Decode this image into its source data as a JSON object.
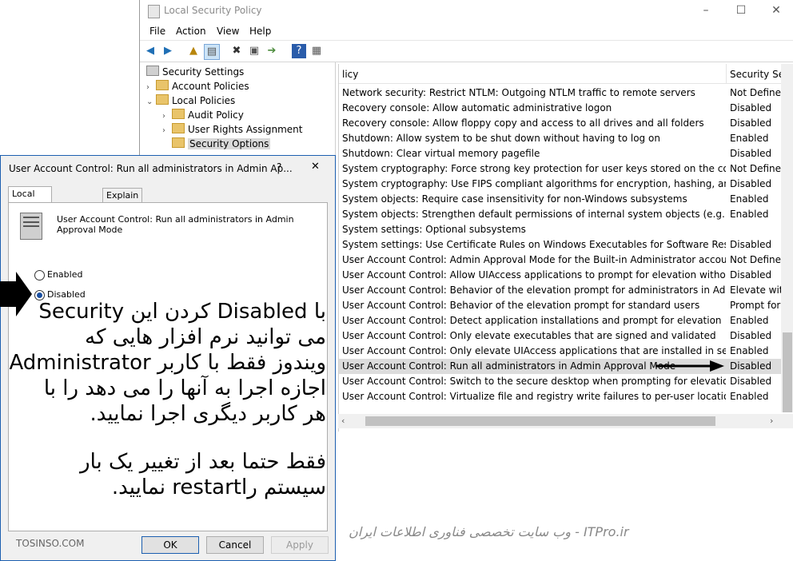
{
  "window": {
    "title": "Local Security Policy",
    "controls": {
      "minimize": "–",
      "maximize": "☐",
      "close": "✕"
    }
  },
  "menu": {
    "items": [
      "File",
      "Action",
      "View",
      "Help"
    ]
  },
  "tree": {
    "root": "Security Settings",
    "account_policies": "Account Policies",
    "local_policies": "Local Policies",
    "audit_policy": "Audit Policy",
    "user_rights": "User Rights Assignment",
    "security_options": "Security Options"
  },
  "list": {
    "col_policy": "licy",
    "col_setting": "Security Setti",
    "rows": [
      {
        "policy": "Network security: Restrict NTLM: Outgoing NTLM traffic to remote servers",
        "setting": "Not Defined"
      },
      {
        "policy": "Recovery console: Allow automatic administrative logon",
        "setting": "Disabled"
      },
      {
        "policy": "Recovery console: Allow floppy copy and access to all drives and all folders",
        "setting": "Disabled"
      },
      {
        "policy": "Shutdown: Allow system to be shut down without having to log on",
        "setting": "Enabled"
      },
      {
        "policy": "Shutdown: Clear virtual memory pagefile",
        "setting": "Disabled"
      },
      {
        "policy": "System cryptography: Force strong key protection for user keys stored on the computer",
        "setting": "Not Defined"
      },
      {
        "policy": "System cryptography: Use FIPS compliant algorithms for encryption, hashing, and signing",
        "setting": "Disabled"
      },
      {
        "policy": "System objects: Require case insensitivity for non-Windows subsystems",
        "setting": "Enabled"
      },
      {
        "policy": "System objects: Strengthen default permissions of internal system objects (e.g. Symbolic ...",
        "setting": "Enabled"
      },
      {
        "policy": "System settings: Optional subsystems",
        "setting": ""
      },
      {
        "policy": "System settings: Use Certificate Rules on Windows Executables for Software Restriction P...",
        "setting": "Disabled"
      },
      {
        "policy": "User Account Control: Admin Approval Mode for the Built-in Administrator account",
        "setting": "Not Defined"
      },
      {
        "policy": "User Account Control: Allow UIAccess applications to prompt for elevation without usin...",
        "setting": "Disabled"
      },
      {
        "policy": "User Account Control: Behavior of the elevation prompt for administrators in Admin App...",
        "setting": "Elevate with"
      },
      {
        "policy": "User Account Control: Behavior of the elevation prompt for standard users",
        "setting": "Prompt for c"
      },
      {
        "policy": "User Account Control: Detect application installations and prompt for elevation",
        "setting": "Enabled"
      },
      {
        "policy": "User Account Control: Only elevate executables that are signed and validated",
        "setting": "Disabled"
      },
      {
        "policy": "User Account Control: Only elevate UIAccess applications that are installed in secure loca...",
        "setting": "Enabled"
      },
      {
        "policy": "User Account Control: Run all administrators in Admin Approval Mode",
        "setting": "Disabled",
        "highlighted": true
      },
      {
        "policy": "User Account Control: Switch to the secure desktop when prompting for elevation",
        "setting": "Disabled"
      },
      {
        "policy": "User Account Control: Virtualize file and registry write failures to per-user locations",
        "setting": "Enabled"
      }
    ]
  },
  "dialog": {
    "title": "User Account Control: Run all administrators in Admin Ap...",
    "help": "?",
    "close": "✕",
    "tab_local": "Local Security Setting",
    "tab_explain": "Explain",
    "policy_name": "User Account Control: Run all administrators in Admin Approval Mode",
    "enabled_label": "Enabled",
    "disabled_label": "Disabled",
    "selected": "Disabled",
    "ok": "OK",
    "cancel": "Cancel",
    "apply": "Apply"
  },
  "annotation": {
    "line1": "با Disabled کردن این Security",
    "line2": "می توانید نرم افزار هایی که",
    "line3": "ویندوز فقط با کاربر Administrator",
    "line4": "اجازه اجرا به آنها را می دهد را با",
    "line5": "هر کاربر دیگری اجرا نمایید.",
    "line6": "فقط حتما بعد از تغییر یک بار",
    "line7": "سیستم راrestart نمایید."
  },
  "watermark": {
    "left": "TOSINSO.COM",
    "right": "ITPro.ir - وب سایت تخصصی فناوری اطلاعات ایران"
  }
}
